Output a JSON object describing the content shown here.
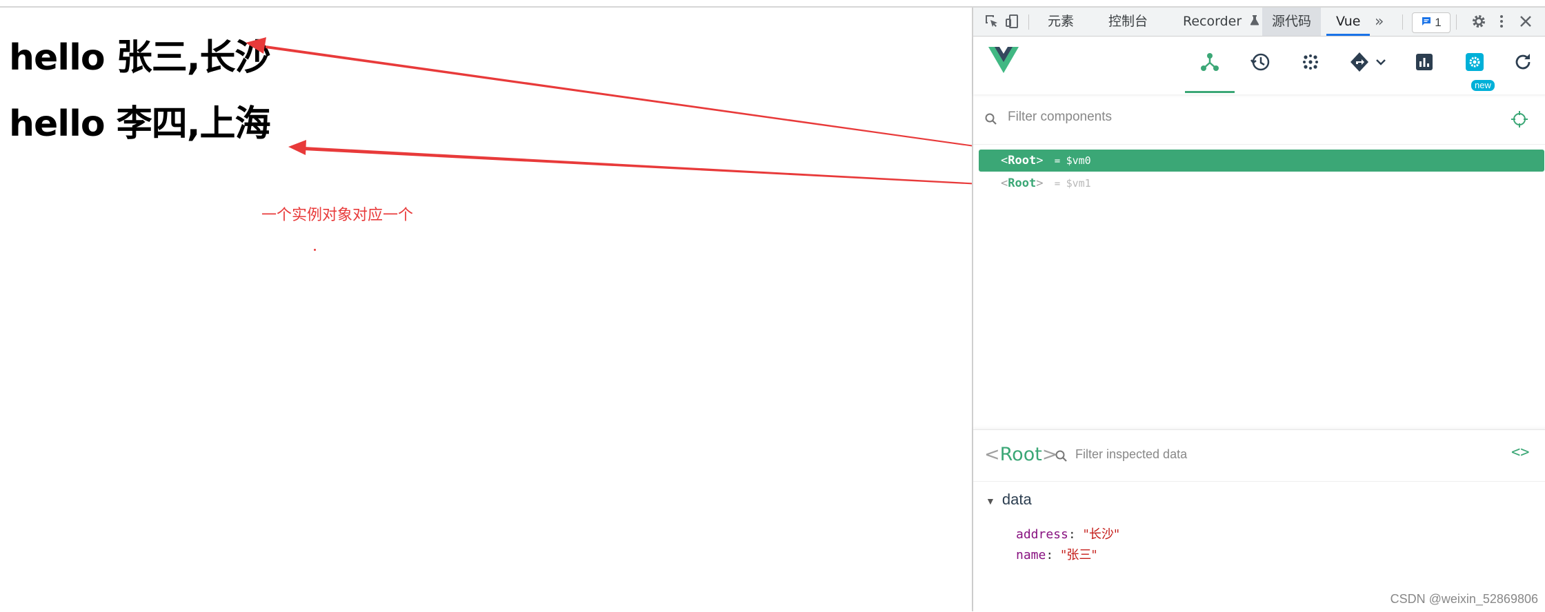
{
  "page": {
    "line1": "hello 张三,长沙",
    "line2": "hello 李四,上海",
    "annotation": "一个实例对象对应一个"
  },
  "devtools": {
    "tabs": [
      "元素",
      "控制台",
      "Recorder",
      "源代码",
      "Vue"
    ],
    "recorder_icon": "flask-icon",
    "more": "»",
    "issues_count": "1",
    "new_badge": "new",
    "filter_placeholder": "Filter components",
    "tree": [
      {
        "name": "Root",
        "ref": "$vm0",
        "selected": true
      },
      {
        "name": "Root",
        "ref": "$vm1",
        "selected": false
      }
    ],
    "inspector": {
      "title": "Root",
      "filter_placeholder": "Filter inspected data",
      "section": "data",
      "props": [
        {
          "key": "address",
          "value": "\"长沙\""
        },
        {
          "key": "name",
          "value": "\"张三\""
        }
      ]
    }
  },
  "watermark": "CSDN @weixin_52869806",
  "colors": {
    "vue_green": "#3ba776",
    "arrow_red": "#e83a3a",
    "accent_blue": "#1a73e8"
  }
}
